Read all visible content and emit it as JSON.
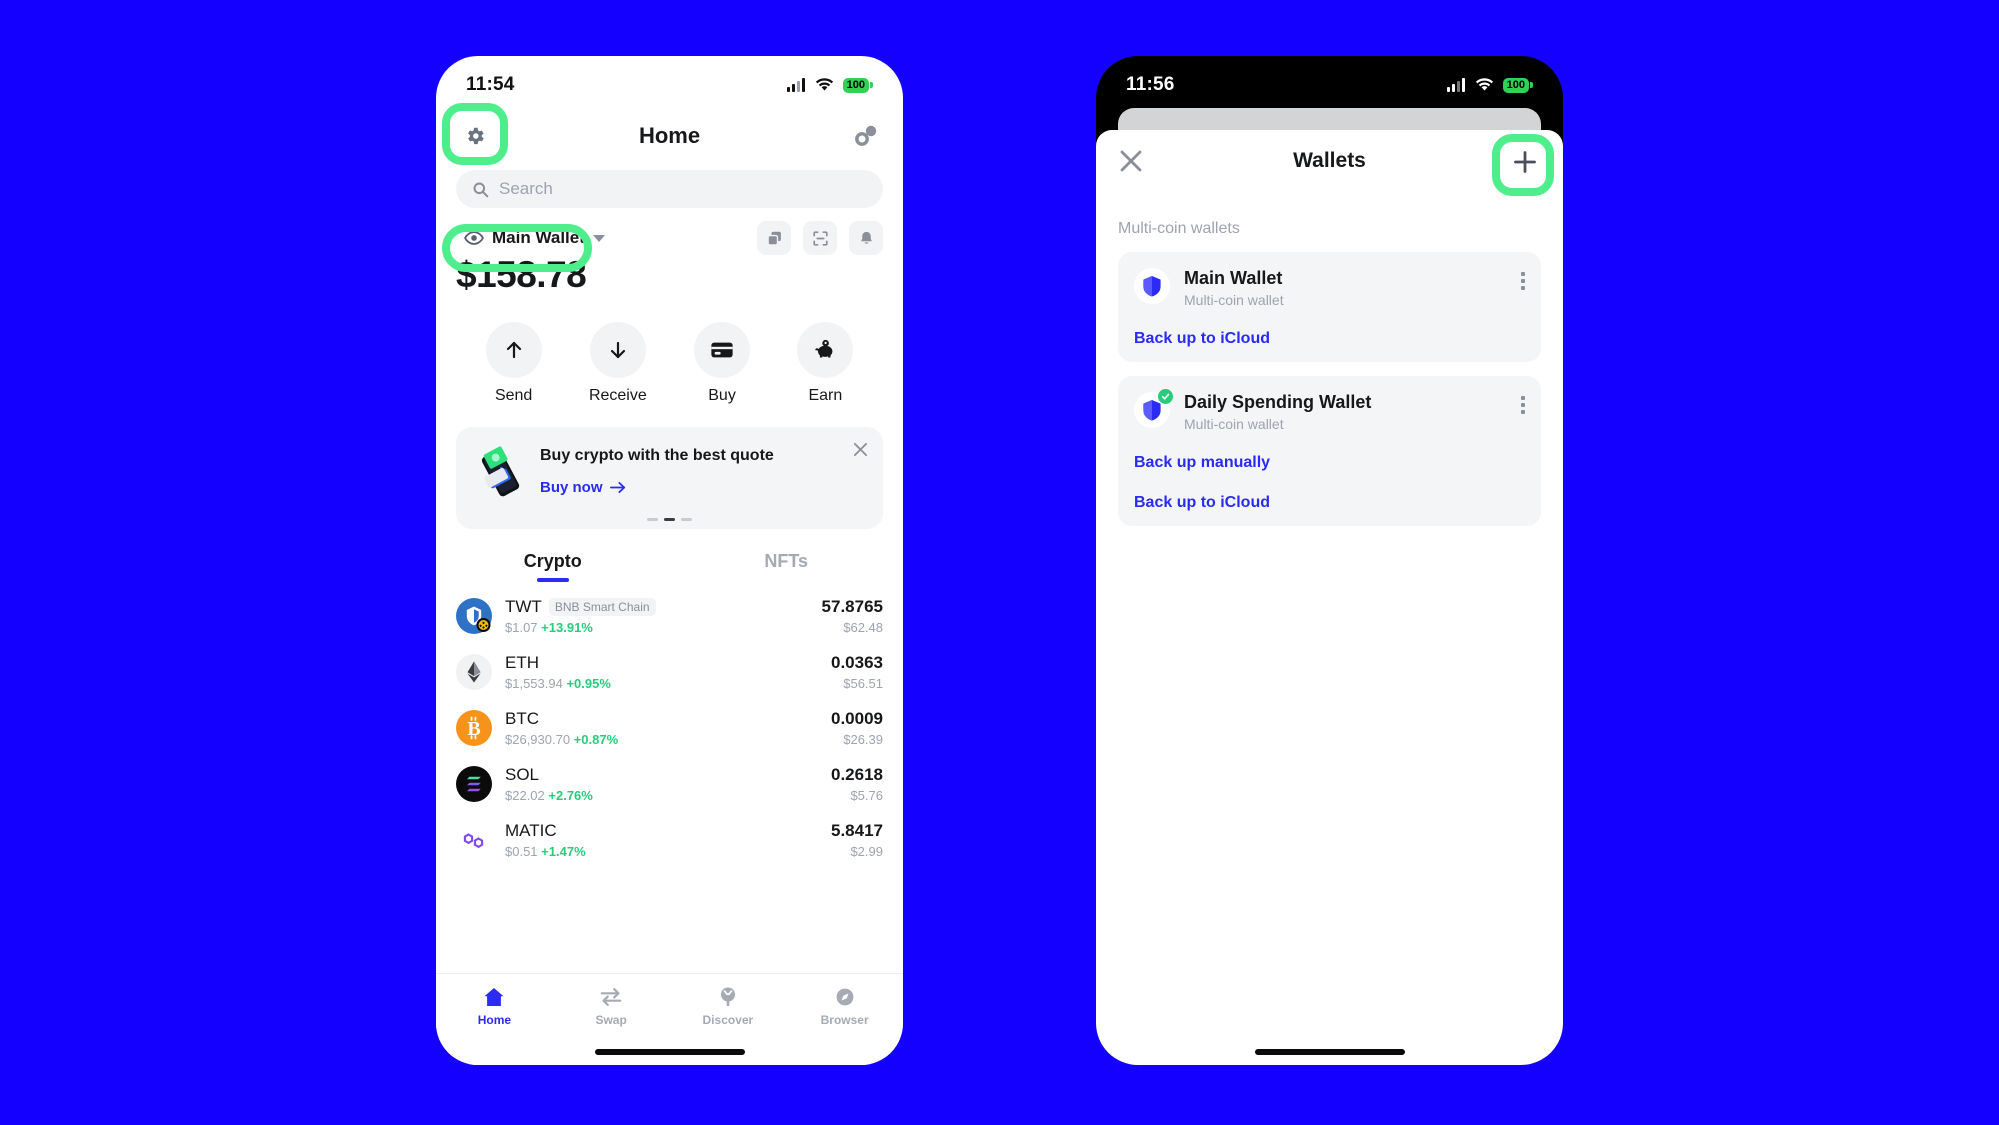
{
  "canvas": {
    "background_color": "#1400FF",
    "highlight_color": "#4FEE8D"
  },
  "left_phone": {
    "status": {
      "time": "11:54",
      "battery": "100",
      "wifi_icon": "wifi-icon",
      "cellular_icon": "cellular-signal-icon"
    },
    "header": {
      "title": "Home",
      "settings_icon": "gear-icon",
      "walletconnect_icon": "walletconnect-link-icon"
    },
    "search": {
      "placeholder": "Search",
      "icon": "search-icon"
    },
    "wallet_selector": {
      "label": "Main Wallet",
      "eye_icon": "eye-icon",
      "caret_icon": "chevron-down-icon"
    },
    "quick_icons": [
      {
        "name": "copy-address-icon"
      },
      {
        "name": "qr-scan-icon"
      },
      {
        "name": "notifications-bell-icon"
      }
    ],
    "balance": "$158.78",
    "actions": [
      {
        "label": "Send",
        "icon": "arrow-up-icon"
      },
      {
        "label": "Receive",
        "icon": "arrow-down-icon"
      },
      {
        "label": "Buy",
        "icon": "credit-card-icon"
      },
      {
        "label": "Earn",
        "icon": "piggy-bank-icon"
      }
    ],
    "promo": {
      "title": "Buy crypto with the best quote",
      "cta": "Buy now",
      "cta_arrow": "arrow-right-icon",
      "close_icon": "close-icon",
      "art_icon": "phone-with-cash-illustration",
      "dots": [
        false,
        true,
        false
      ]
    },
    "tabs": [
      {
        "label": "Crypto",
        "active": true
      },
      {
        "label": "NFTs",
        "active": false
      }
    ],
    "assets": [
      {
        "symbol": "TWT",
        "chain": "BNB Smart Chain",
        "price": "$1.07",
        "change": "+13.91%",
        "amount": "57.8765",
        "value": "$62.48",
        "logo": "twt-token-icon"
      },
      {
        "symbol": "ETH",
        "chain": "",
        "price": "$1,553.94",
        "change": "+0.95%",
        "amount": "0.0363",
        "value": "$56.51",
        "logo": "eth-token-icon"
      },
      {
        "symbol": "BTC",
        "chain": "",
        "price": "$26,930.70",
        "change": "+0.87%",
        "amount": "0.0009",
        "value": "$26.39",
        "logo": "btc-token-icon"
      },
      {
        "symbol": "SOL",
        "chain": "",
        "price": "$22.02",
        "change": "+2.76%",
        "amount": "0.2618",
        "value": "$5.76",
        "logo": "sol-token-icon"
      },
      {
        "symbol": "MATIC",
        "chain": "",
        "price": "$0.51",
        "change": "+1.47%",
        "amount": "5.8417",
        "value": "$2.99",
        "logo": "matic-token-icon"
      }
    ],
    "bottom_nav": [
      {
        "label": "Home",
        "icon": "home-icon",
        "active": true
      },
      {
        "label": "Swap",
        "icon": "swap-icon",
        "active": false
      },
      {
        "label": "Discover",
        "icon": "discover-icon",
        "active": false
      },
      {
        "label": "Browser",
        "icon": "compass-icon",
        "active": false
      }
    ]
  },
  "right_phone": {
    "status": {
      "time": "11:56",
      "battery": "100",
      "wifi_icon": "wifi-icon",
      "cellular_icon": "cellular-signal-icon"
    },
    "header": {
      "title": "Wallets",
      "close_icon": "close-icon",
      "add_icon": "plus-icon"
    },
    "section_label": "Multi-coin wallets",
    "wallets": [
      {
        "name": "Main Wallet",
        "subtitle": "Multi-coin wallet",
        "verified": false,
        "shield_icon": "shield-icon",
        "menu_icon": "more-vertical-icon",
        "links": [
          "Back up to iCloud"
        ]
      },
      {
        "name": "Daily Spending Wallet",
        "subtitle": "Multi-coin wallet",
        "verified": true,
        "shield_icon": "shield-icon",
        "badge_icon": "check-badge-icon",
        "menu_icon": "more-vertical-icon",
        "links": [
          "Back up manually",
          "Back up to iCloud"
        ]
      }
    ]
  }
}
